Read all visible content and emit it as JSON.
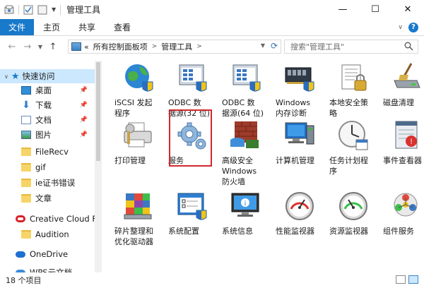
{
  "window": {
    "title": "管理工具",
    "minimize": "—",
    "maximize": "☐",
    "close": "✕"
  },
  "ribbon": {
    "tabs": [
      "文件",
      "主页",
      "共享",
      "查看"
    ],
    "help": "?"
  },
  "address": {
    "back": "←",
    "forward": "→",
    "up": "↑",
    "crumbs": [
      "所有控制面板项",
      "管理工具"
    ],
    "overflow": "«",
    "search_placeholder": "搜索\"管理工具\""
  },
  "sidebar": {
    "items": [
      {
        "label": "快速访问",
        "icon": "star-icon"
      },
      {
        "label": "桌面",
        "icon": "desktop-icon",
        "pinned": true
      },
      {
        "label": "下载",
        "icon": "download-icon",
        "pinned": true
      },
      {
        "label": "文档",
        "icon": "document-icon",
        "pinned": true
      },
      {
        "label": "图片",
        "icon": "picture-icon",
        "pinned": true
      },
      {
        "label": "FileRecv",
        "icon": "folder-icon"
      },
      {
        "label": "gif",
        "icon": "folder-icon"
      },
      {
        "label": "ie证书错误",
        "icon": "folder-icon"
      },
      {
        "label": "文章",
        "icon": "folder-icon"
      },
      {
        "label": "Creative Cloud Fil",
        "icon": "creative-cloud-icon"
      },
      {
        "label": "Audition",
        "icon": "folder-icon"
      },
      {
        "label": "OneDrive",
        "icon": "onedrive-icon"
      },
      {
        "label": "WPS云文档",
        "icon": "wps-cloud-icon"
      }
    ]
  },
  "files": [
    {
      "label": "iSCSI 发起\n程序",
      "icon": "iscsi-globe-icon"
    },
    {
      "label": "ODBC 数\n据源(32 位)",
      "icon": "odbc-32-icon"
    },
    {
      "label": "ODBC 数\n据源(64 位)",
      "icon": "odbc-64-icon"
    },
    {
      "label": "Windows\n内存诊断",
      "icon": "memory-diagnostic-icon"
    },
    {
      "label": "本地安全策\n略",
      "icon": "local-security-policy-icon"
    },
    {
      "label": "磁盘清理",
      "icon": "disk-cleanup-icon"
    },
    {
      "label": "打印管理",
      "icon": "print-management-icon"
    },
    {
      "label": "服务",
      "icon": "services-gears-icon"
    },
    {
      "label": "高级安全\nWindows\n防火墙",
      "icon": "firewall-icon"
    },
    {
      "label": "计算机管理",
      "icon": "computer-management-icon"
    },
    {
      "label": "任务计划程\n序",
      "icon": "task-scheduler-icon"
    },
    {
      "label": "事件查看器",
      "icon": "event-viewer-icon"
    },
    {
      "label": "碎片整理和\n优化驱动器",
      "icon": "defragment-icon"
    },
    {
      "label": "系统配置",
      "icon": "system-configuration-icon"
    },
    {
      "label": "系统信息",
      "icon": "system-information-icon"
    },
    {
      "label": "性能监视器",
      "icon": "performance-monitor-icon"
    },
    {
      "label": "资源监视器",
      "icon": "resource-monitor-icon"
    },
    {
      "label": "组件服务",
      "icon": "component-services-icon"
    }
  ],
  "status": {
    "count": "18 个项目"
  },
  "colors": {
    "accent": "#1979ca",
    "selection": "#cce8ff",
    "highlight_box": "#d3282c"
  }
}
